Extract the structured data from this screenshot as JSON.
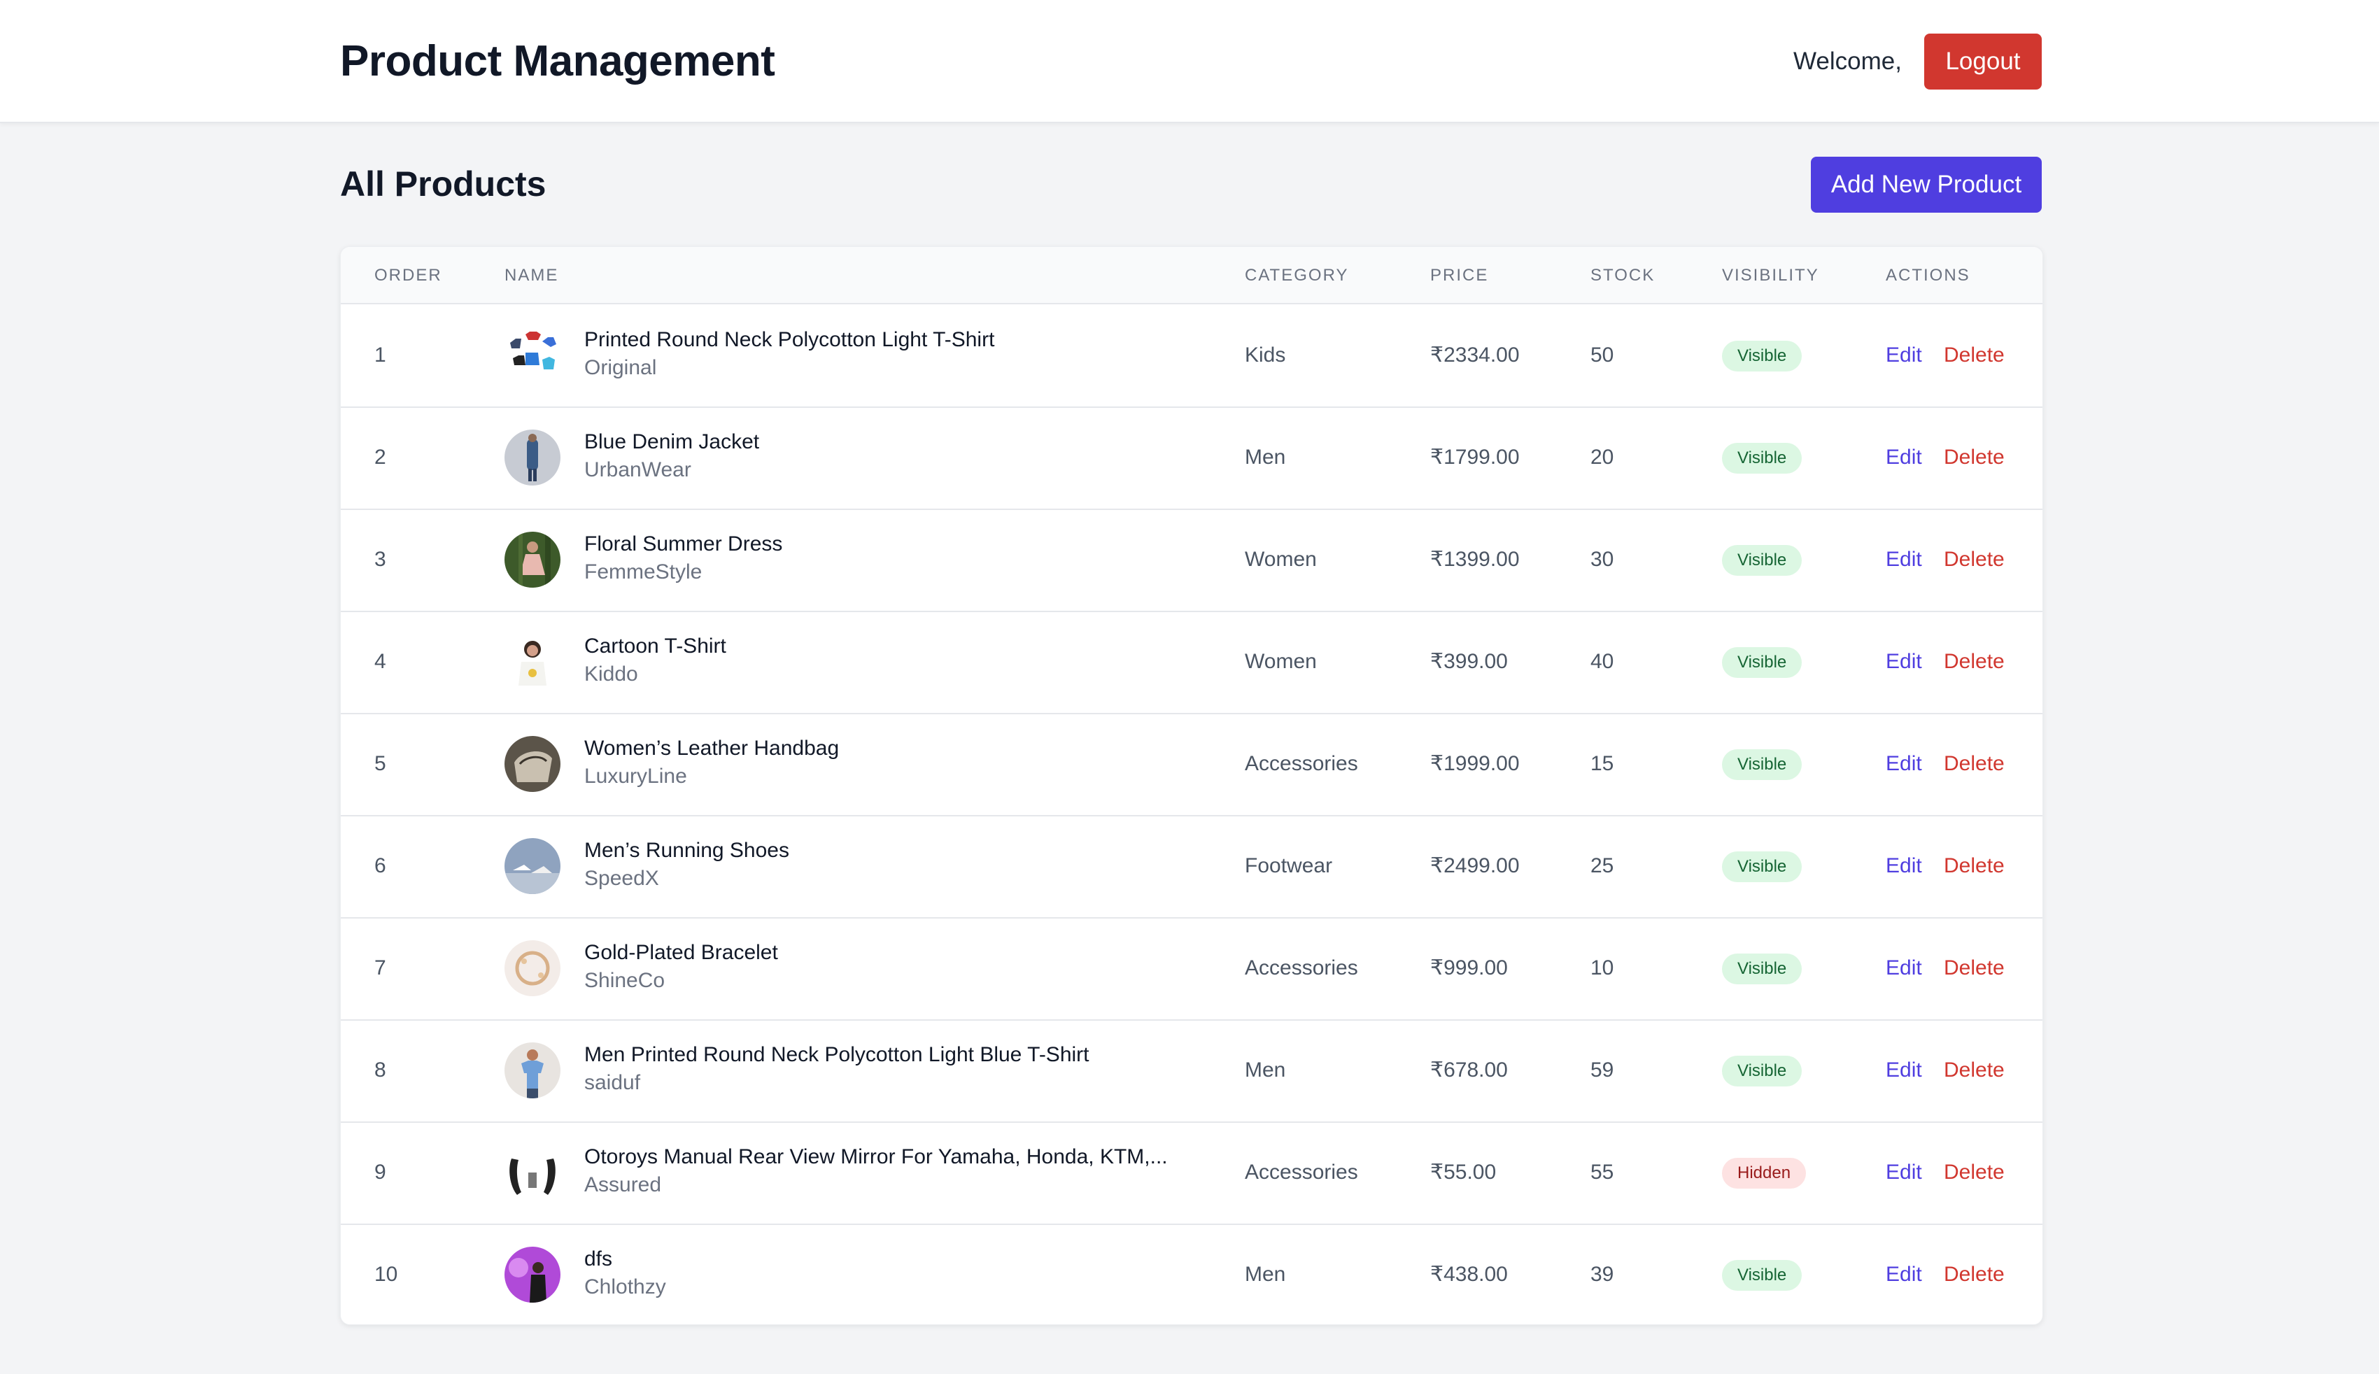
{
  "header": {
    "title": "Product Management",
    "welcome": "Welcome,",
    "logout_label": "Logout"
  },
  "main": {
    "title": "All Products",
    "add_label": "Add New Product"
  },
  "table": {
    "columns": [
      "ORDER",
      "NAME",
      "CATEGORY",
      "PRICE",
      "STOCK",
      "VISIBILITY",
      "ACTIONS"
    ],
    "edit_label": "Edit",
    "delete_label": "Delete",
    "rows": [
      {
        "order": "1",
        "name": "Printed Round Neck Polycotton Light T-Shirt",
        "brand": "Original",
        "category": "Kids",
        "price": "₹2334.00",
        "stock": "50",
        "visibility": "Visible",
        "thumb": "tshirts-icon"
      },
      {
        "order": "2",
        "name": "Blue Denim Jacket",
        "brand": "UrbanWear",
        "category": "Men",
        "price": "₹1799.00",
        "stock": "20",
        "visibility": "Visible",
        "thumb": "jacket-icon"
      },
      {
        "order": "3",
        "name": "Floral Summer Dress",
        "brand": "FemmeStyle",
        "category": "Women",
        "price": "₹1399.00",
        "stock": "30",
        "visibility": "Visible",
        "thumb": "dress-icon"
      },
      {
        "order": "4",
        "name": "Cartoon T-Shirt",
        "brand": "Kiddo",
        "category": "Women",
        "price": "₹399.00",
        "stock": "40",
        "visibility": "Visible",
        "thumb": "cartoon-tshirt-icon"
      },
      {
        "order": "5",
        "name": "Women’s Leather Handbag",
        "brand": "LuxuryLine",
        "category": "Accessories",
        "price": "₹1999.00",
        "stock": "15",
        "visibility": "Visible",
        "thumb": "handbag-icon"
      },
      {
        "order": "6",
        "name": "Men’s Running Shoes",
        "brand": "SpeedX",
        "category": "Footwear",
        "price": "₹2499.00",
        "stock": "25",
        "visibility": "Visible",
        "thumb": "shoes-icon"
      },
      {
        "order": "7",
        "name": "Gold-Plated Bracelet",
        "brand": "ShineCo",
        "category": "Accessories",
        "price": "₹999.00",
        "stock": "10",
        "visibility": "Visible",
        "thumb": "bracelet-icon"
      },
      {
        "order": "8",
        "name": "Men Printed Round Neck Polycotton Light Blue T-Shirt",
        "brand": "saiduf",
        "category": "Men",
        "price": "₹678.00",
        "stock": "59",
        "visibility": "Visible",
        "thumb": "blue-tshirt-icon"
      },
      {
        "order": "9",
        "name": "Otoroys Manual Rear View Mirror For Yamaha, Honda, KTM,...",
        "brand": "Assured",
        "category": "Accessories",
        "price": "₹55.00",
        "stock": "55",
        "visibility": "Hidden",
        "thumb": "mirror-icon"
      },
      {
        "order": "10",
        "name": "dfs",
        "brand": "Chlothzy",
        "category": "Men",
        "price": "₹438.00",
        "stock": "39",
        "visibility": "Visible",
        "thumb": "promo-icon"
      }
    ]
  },
  "colors": {
    "primary": "#4f3ee0",
    "danger": "#d1372f",
    "visible_bg": "#dcf7e3",
    "hidden_bg": "#fde2e2"
  }
}
